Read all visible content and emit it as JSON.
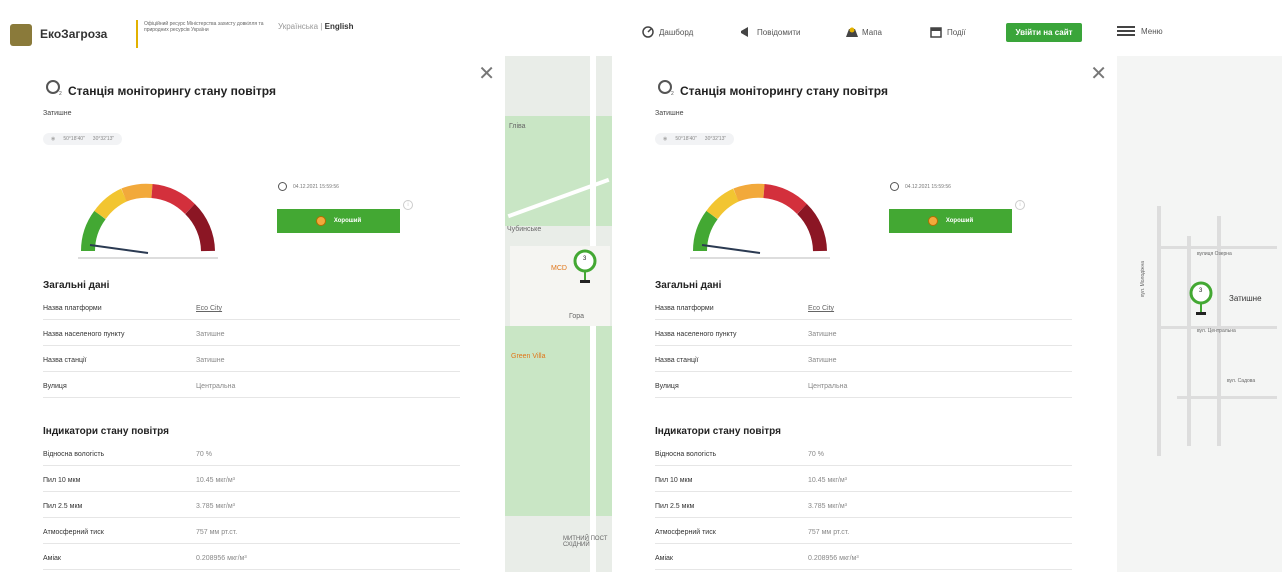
{
  "header": {
    "brand": "ЕкоЗагроза",
    "org": "Офіційний ресурс Міністерства захисту довкілля та природних ресурсів України",
    "lang_ua": "Українська",
    "lang_sep": "|",
    "lang_en": "English",
    "nav": [
      {
        "label": "Дашборд",
        "icon": "dashboard-icon"
      },
      {
        "label": "Повідомити",
        "icon": "megaphone-icon"
      },
      {
        "label": "Мапа",
        "icon": "map-icon"
      },
      {
        "label": "Події",
        "icon": "events-icon"
      }
    ],
    "login": "Увійти на сайт",
    "menu": "Меню"
  },
  "panel": {
    "o2_label": "2",
    "title": "Станція моніторингу стану повітря",
    "subtitle": "Затишне",
    "coord1": "50°18'40\"",
    "coord2": "30°32'13\"",
    "datetime": "04.12.2021 15:59:56",
    "quality": "Хороший",
    "info": "i",
    "general_title": "Загальні дані",
    "general": [
      {
        "k": "Назва платформи",
        "v": "Eco City"
      },
      {
        "k": "Назва населеного пункту",
        "v": "Затишне"
      },
      {
        "k": "Назва станції",
        "v": "Затишне"
      },
      {
        "k": "Вулиця",
        "v": "Центральна"
      }
    ],
    "indicators_title": "Індикатори стану повітря",
    "indicators": [
      {
        "k": "Відносна вологість",
        "v": "70 %"
      },
      {
        "k": "Пил 10 мкм",
        "v": "10.45 мкг/м³"
      },
      {
        "k": "Пил 2.5 мкм",
        "v": "3.785 мкг/м³"
      },
      {
        "k": "Атмосферний тиск",
        "v": "757 мм рт.ст."
      },
      {
        "k": "Аміак",
        "v": "0.208956 мкг/м³"
      }
    ],
    "close": "✕"
  },
  "map1": {
    "labels": [
      "Гліва",
      "Чубинське",
      "Гора",
      "Green Villa",
      "MCD",
      "МИТНИЙ ПОСТ СХІДНИЙ"
    ],
    "pin_label": "3"
  },
  "map2": {
    "labels": [
      "Затишне",
      "вул. Молодіжна",
      "вулиця Озерна",
      "вул. Центральна",
      "вул. Садова"
    ],
    "pin_label": "3"
  },
  "colors": {
    "accent_green": "#3aa53a",
    "gauge_green": "#43a833",
    "gauge_yellow": "#f2c531",
    "gauge_orange": "#f2a93b",
    "gauge_red": "#d3303c",
    "gauge_darkred": "#8b1624"
  }
}
